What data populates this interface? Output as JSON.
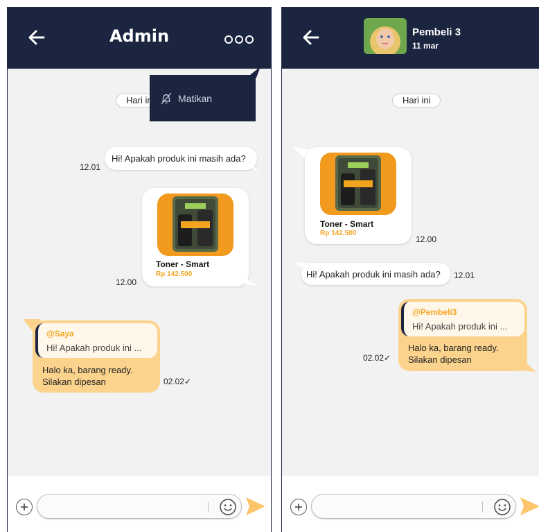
{
  "left": {
    "header": {
      "title": "Admin"
    },
    "date_pill": "Hari ini",
    "menu": {
      "mute_label": "Matikan"
    },
    "messages": {
      "incoming_text": "Hi! Apakah produk ini masih ada?",
      "incoming_time": "12.01",
      "product_name": "Toner - Smart",
      "product_price": "Rp 142.500",
      "product_time": "12.00",
      "reply_quote_name": "@Saya",
      "reply_quote_text": "Hi! Apakah produk ini ...",
      "reply_line1": "Halo ka, barang ready.",
      "reply_line2": "Silakan dipesan",
      "reply_time": "02.02"
    },
    "input": {
      "placeholder": ""
    }
  },
  "right": {
    "header": {
      "contact_name": "Pembeli 3",
      "contact_date": "11 mar"
    },
    "date_pill": "Hari ini",
    "messages": {
      "product_name": "Toner - Smart",
      "product_price": "Rp 142.500",
      "product_time": "12.00",
      "incoming_text": "Hi! Apakah produk ini masih ada?",
      "incoming_time": "12.01",
      "reply_quote_name": "@Pembeli3",
      "reply_quote_text": "Hi! Apakah produk ini ...",
      "reply_line1": "Halo ka, barang ready.",
      "reply_line2": "Silakan dipesan",
      "reply_time": "02.02"
    },
    "input": {
      "placeholder": ""
    }
  },
  "icons": {
    "back": "arrow-left-icon",
    "more": "more-dots-icon",
    "mute": "bell-off-icon",
    "add": "plus-circle-icon",
    "emoji": "smiley-icon",
    "send": "send-icon",
    "read": "check-icon"
  },
  "colors": {
    "header": "#1c2540",
    "accent": "#f5a623",
    "reply_bubble": "#fcd38d",
    "background": "#f2f2f2"
  }
}
